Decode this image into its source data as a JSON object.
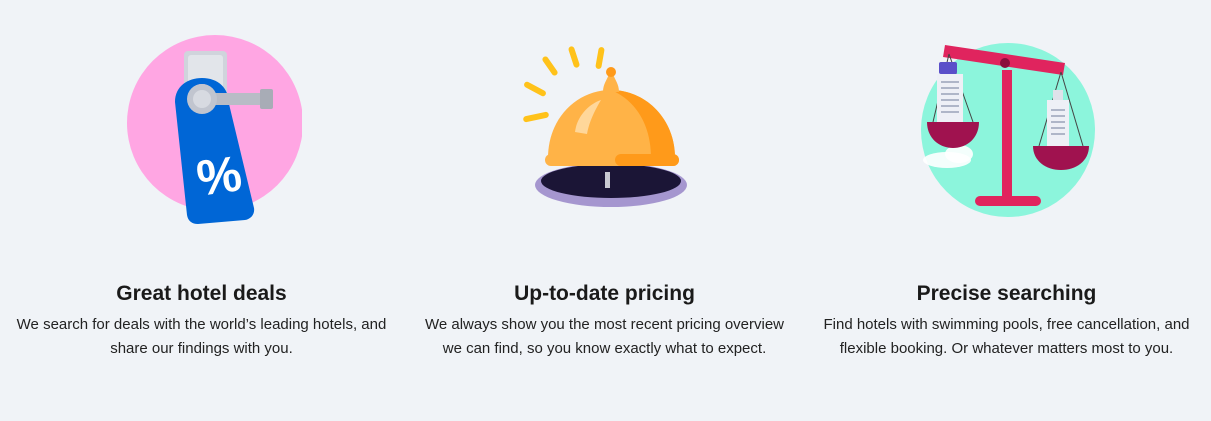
{
  "features": [
    {
      "title": "Great hotel deals",
      "description": "We search for deals with the world’s leading hotels, and share our findings with you.",
      "icon": "door-hanger-discount-icon",
      "colors": {
        "circle": "#ffa6e3",
        "tag": "#0066d6"
      }
    },
    {
      "title": "Up-to-date pricing",
      "description": "We always show you the most recent pricing overview we can find, so you know exactly what to expect.",
      "icon": "service-bell-icon",
      "colors": {
        "bell": "#ffb347",
        "base": "#1b1536"
      }
    },
    {
      "title": "Precise searching",
      "description": "Find hotels with swimming pools, free cancellation, and flexible booking. Or whatever matters most to you.",
      "icon": "balance-scale-icon",
      "colors": {
        "circle": "#8cf5dc",
        "scale": "#e0245e"
      }
    }
  ]
}
